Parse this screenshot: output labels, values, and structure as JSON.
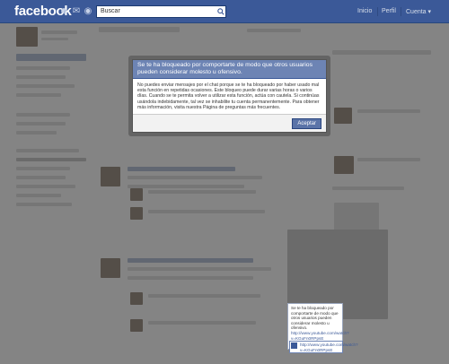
{
  "header": {
    "logo": "facebook",
    "search_placeholder": "Buscar",
    "nav": [
      "Inicio",
      "Perfil",
      "Cuenta ▾"
    ]
  },
  "icons": [
    "friend-requests-icon",
    "messages-icon",
    "notifications-icon",
    "search-icon"
  ],
  "modal": {
    "title": "Se te ha bloqueado por comportarte de modo que otros usuarios pueden considerar molesto u ofensivo.",
    "body": "No puedes enviar mensajes por el chat porque se te ha bloqueado por haber usado mal esta función en repetidas ocasiones. Este bloqueo puede durar varias horas o varios días. Cuando se te permita volver a utilizar esta función, actúa con cautela. Si continúas usándola indebidamente, tal vez se inhabilite tu cuenta permanentemente. Para obtener más información, visita nuestra Página de preguntas más frecuentes.",
    "accept_label": "Aceptar"
  },
  "chat_popup": {
    "message": "Se te ha bloqueado por comportarte de modo que otros usuarios pueden considerar molesto u ofensivo.",
    "link": "http://www.youtube.com/watch?v=KGuFn0RPpsE",
    "link2": "http://www.youtube.com/watch?v=KGuFn0RPpsE"
  },
  "colors": {
    "brand": "#3b5998",
    "modal_header": "#6d84b4"
  }
}
